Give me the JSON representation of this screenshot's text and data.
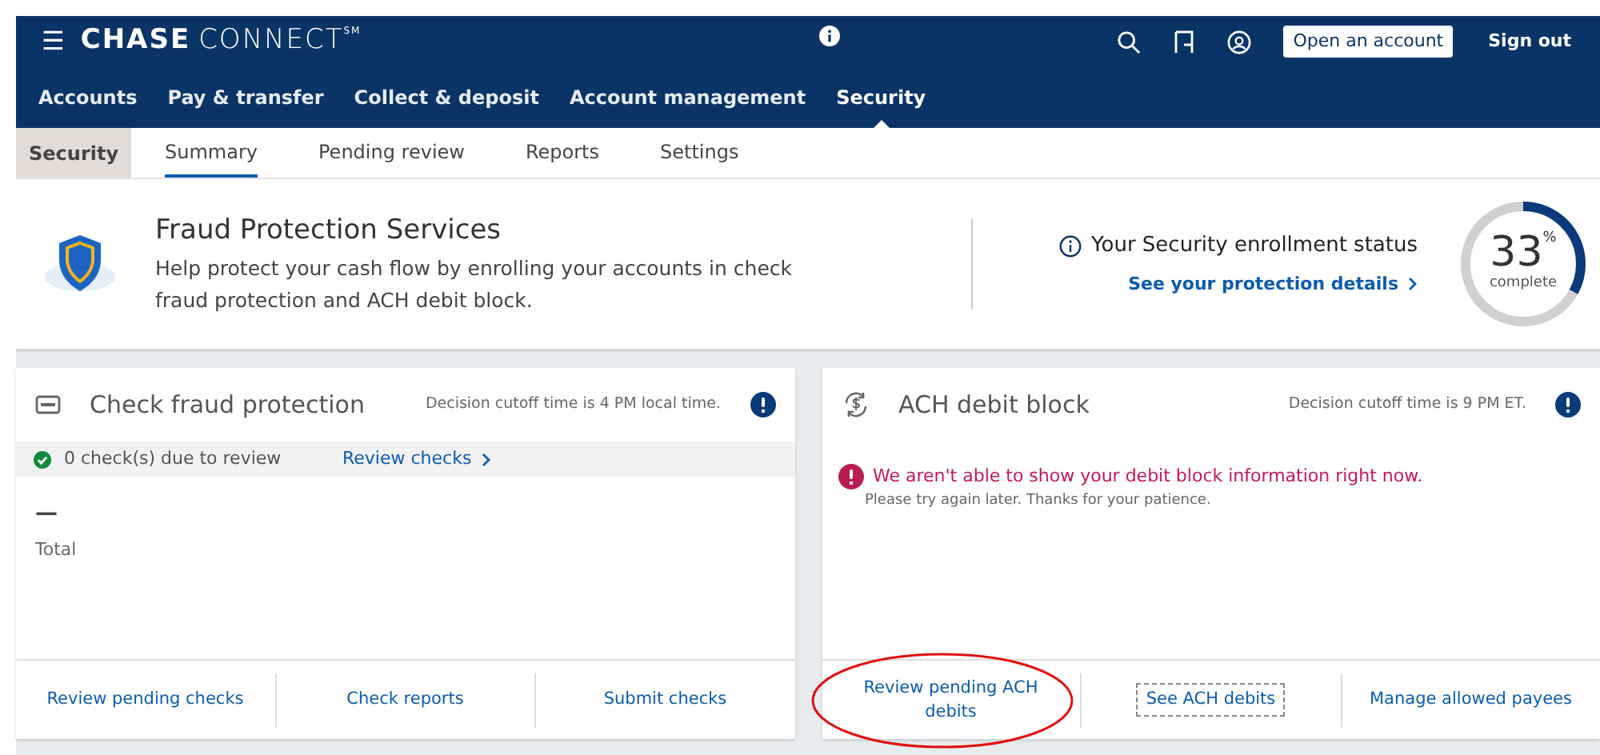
{
  "header": {
    "menu_icon": "☰",
    "logo": {
      "brand": "CHASE",
      "product": "CONNECT",
      "mark": "SM"
    },
    "buttons": [
      {
        "label": "Open an account",
        "kind": "outlined"
      },
      {
        "label": "Sign out",
        "kind": "plain"
      }
    ]
  },
  "main_nav": [
    {
      "label": "Accounts",
      "selected": false
    },
    {
      "label": "Pay & transfer",
      "selected": false
    },
    {
      "label": "Collect & deposit",
      "selected": false
    },
    {
      "label": "Account management",
      "selected": false
    },
    {
      "label": "Security",
      "selected": true
    }
  ],
  "sub_nav": {
    "section": "Security",
    "tabs": [
      {
        "label": "Summary",
        "selected": true
      },
      {
        "label": "Pending review",
        "selected": false
      },
      {
        "label": "Reports",
        "selected": false
      },
      {
        "label": "Settings",
        "selected": false
      }
    ]
  },
  "banner": {
    "title": "Fraud Protection Services",
    "description": "Help protect your cash flow by enrolling your accounts in check fraud protection and ACH debit block.",
    "status_title": "Your Security enrollment status",
    "status_link": "See your protection details",
    "progress": {
      "value": "33",
      "unit": "%",
      "caption": "complete"
    }
  },
  "cards": [
    {
      "kind": "check",
      "title": "Check fraud protection",
      "cutoff": "Decision cutoff time is 4 PM local time.",
      "summary": {
        "text": "0 check(s) due to review",
        "link": "Review checks"
      },
      "total_value": "—",
      "total_label": "Total",
      "links": [
        {
          "label": "Review pending checks",
          "focused": false,
          "circled": false
        },
        {
          "label": "Check reports",
          "focused": false,
          "circled": false
        },
        {
          "label": "Submit checks",
          "focused": false,
          "circled": false
        }
      ]
    },
    {
      "kind": "ach",
      "title": "ACH debit block",
      "cutoff": "Decision cutoff time is 9 PM ET.",
      "error": {
        "title": "We aren't able to show your debit block information right now.",
        "detail": "Please try again later. Thanks for your patience."
      },
      "links": [
        {
          "label": "Review pending ACH debits",
          "focused": false,
          "circled": true
        },
        {
          "label": "See ACH debits",
          "focused": true,
          "circled": false
        },
        {
          "label": "Manage allowed payees",
          "focused": false,
          "circled": false
        }
      ]
    }
  ]
}
